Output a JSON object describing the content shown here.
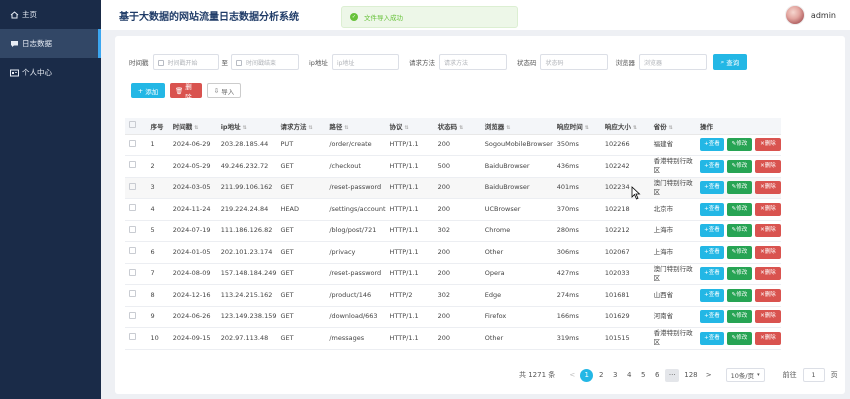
{
  "sidebar": {
    "items": [
      {
        "label": "主页",
        "icon": "home-icon"
      },
      {
        "label": "日志数据",
        "icon": "message-icon"
      },
      {
        "label": "个人中心",
        "icon": "id-card-icon"
      }
    ]
  },
  "header": {
    "title": "基于大数据的网站流量日志数据分析系统",
    "user": "admin"
  },
  "toast": {
    "text": "文件导入成功",
    "icon": "check-circle-icon",
    "color": "#67c23a"
  },
  "filters": {
    "time_label": "时间戳",
    "time_start_placeholder": "时间戳开始",
    "time_to": "至",
    "time_end_placeholder": "时间戳结束",
    "ip_label": "ip地址",
    "ip_placeholder": "ip地址",
    "method_label": "请求方法",
    "method_placeholder": "请求方法",
    "status_label": "状态码",
    "status_placeholder": "状态码",
    "browser_label": "浏览器",
    "browser_placeholder": "浏览器",
    "query_label": "查询"
  },
  "toolbar": {
    "add_label": "添加",
    "delete_label": "删除",
    "import_label": "导入"
  },
  "table": {
    "headers": [
      "序号",
      "时间戳",
      "ip地址",
      "请求方法",
      "路径",
      "协议",
      "状态码",
      "浏览器",
      "响应时间",
      "响应大小",
      "省份",
      "操作"
    ],
    "action_labels": {
      "view": "查看",
      "edit": "修改",
      "delete": "删除"
    },
    "rows": [
      [
        "1",
        "2024-06-29",
        "203.28.185.44",
        "PUT",
        "/order/create",
        "HTTP/1.1",
        "200",
        "SogouMobileBrowser",
        "350ms",
        "102266",
        "福建省"
      ],
      [
        "2",
        "2024-05-29",
        "49.246.232.72",
        "GET",
        "/checkout",
        "HTTP/1.1",
        "500",
        "BaiduBrowser",
        "436ms",
        "102242",
        "香港特别行政区"
      ],
      [
        "3",
        "2024-03-05",
        "211.99.106.162",
        "GET",
        "/reset-password",
        "HTTP/1.1",
        "200",
        "BaiduBrowser",
        "401ms",
        "102234",
        "澳门特别行政区"
      ],
      [
        "4",
        "2024-11-24",
        "219.224.24.84",
        "HEAD",
        "/settings/account",
        "HTTP/1.1",
        "200",
        "UCBrowser",
        "370ms",
        "102218",
        "北京市"
      ],
      [
        "5",
        "2024-07-19",
        "111.186.126.82",
        "GET",
        "/blog/post/721",
        "HTTP/1.1",
        "302",
        "Chrome",
        "280ms",
        "102212",
        "上海市"
      ],
      [
        "6",
        "2024-01-05",
        "202.101.23.174",
        "GET",
        "/privacy",
        "HTTP/1.1",
        "200",
        "Other",
        "306ms",
        "102067",
        "上海市"
      ],
      [
        "7",
        "2024-08-09",
        "157.148.184.249",
        "GET",
        "/reset-password",
        "HTTP/1.1",
        "200",
        "Opera",
        "427ms",
        "102033",
        "澳门特别行政区"
      ],
      [
        "8",
        "2024-12-16",
        "113.24.215.162",
        "GET",
        "/product/146",
        "HTTP/2",
        "302",
        "Edge",
        "274ms",
        "101681",
        "山西省"
      ],
      [
        "9",
        "2024-06-26",
        "123.149.238.159",
        "GET",
        "/download/663",
        "HTTP/1.1",
        "200",
        "Firefox",
        "166ms",
        "101629",
        "河南省"
      ],
      [
        "10",
        "2024-09-15",
        "202.97.113.48",
        "GET",
        "/messages",
        "HTTP/1.1",
        "200",
        "Other",
        "319ms",
        "101515",
        "香港特别行政区"
      ]
    ]
  },
  "pagination": {
    "total": "共 1271 条",
    "prev": "<",
    "pages": [
      "1",
      "2",
      "3",
      "4",
      "5",
      "6"
    ],
    "more": "···",
    "last": "128",
    "next": ">",
    "page_size": "10条/页",
    "goto_label": "前往",
    "goto_value": "1",
    "goto_suffix": "页"
  }
}
